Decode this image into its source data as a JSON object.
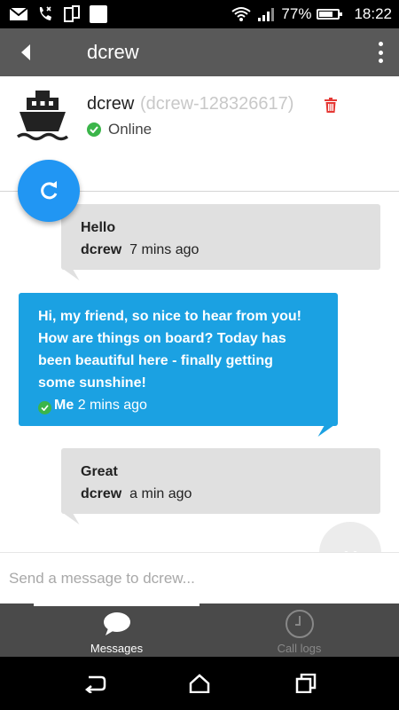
{
  "status_bar": {
    "battery": "77%",
    "battery_level": 0.77,
    "time": "18:22",
    "icons": [
      "mail-icon",
      "missed-call-icon",
      "phone-portrait-icon",
      "blank-notification-icon",
      "wifi-icon",
      "signal-icon",
      "battery-icon"
    ]
  },
  "app_bar": {
    "title": "dcrew",
    "back_icon": "back-arrow-icon",
    "menu_icon": "overflow-menu-icon"
  },
  "contact": {
    "name": "dcrew",
    "id": "(dcrew-128326617)",
    "status": "Online",
    "avatar_icon": "boat-icon",
    "delete_icon": "trash-icon",
    "refresh_icon": "refresh-icon"
  },
  "messages": [
    {
      "direction": "in",
      "text": "Hello",
      "sender": "dcrew",
      "time": "7 mins ago"
    },
    {
      "direction": "out",
      "text_lines": [
        "Hi, my friend, so nice to hear from you!",
        "How are things on board? Today has",
        "been beautiful here - finally getting",
        "some sunshine!"
      ],
      "sender": "Me",
      "time": "2 mins ago"
    },
    {
      "direction": "in",
      "text": "Great",
      "sender": "dcrew",
      "time": "a min ago"
    }
  ],
  "input": {
    "placeholder": "Send a message to dcrew...",
    "value": ""
  },
  "tabs": [
    {
      "label": "Messages",
      "icon": "chat-bubble-icon",
      "active": true
    },
    {
      "label": "Call logs",
      "icon": "clock-icon",
      "active": false
    }
  ],
  "colors": {
    "app_bar": "#595959",
    "accent_blue": "#2196f3",
    "outgoing_bubble": "#1ba1e2",
    "incoming_bubble": "#e0e0e0",
    "online_green": "#3bb54a",
    "delete_red": "#e53935"
  }
}
